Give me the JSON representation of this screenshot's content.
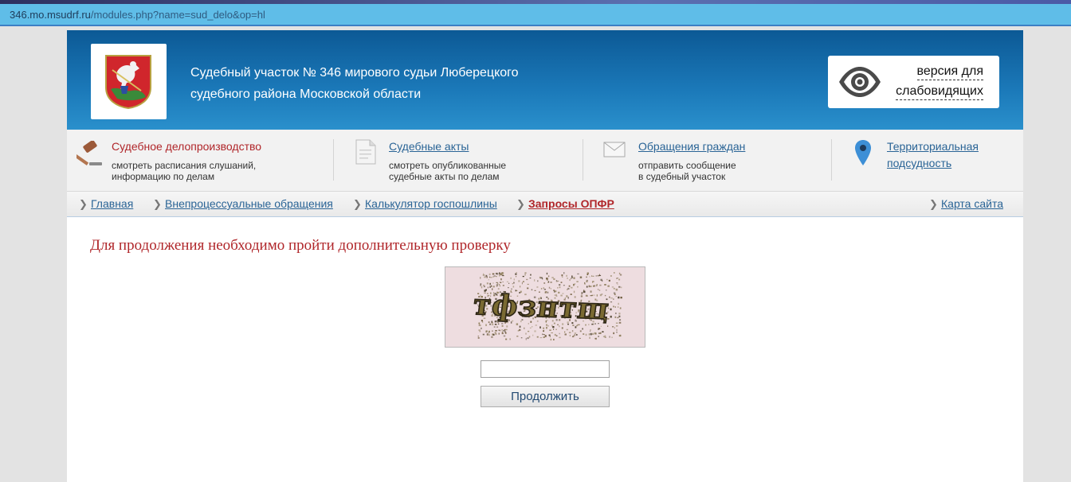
{
  "browser": {
    "url_host": "346.mo.msudrf.ru",
    "url_path": "/modules.php?name=sud_delo&op=hl"
  },
  "header": {
    "title_line1": "Судебный участок № 346 мирового судьи Люберецкого",
    "title_line2": "судебного района Московской области",
    "vision_line1": "версия для",
    "vision_line2": "слабовидящих"
  },
  "menu": [
    {
      "title": "Судебное делопроизводство",
      "sub1": "смотреть расписания слушаний,",
      "sub2": "информацию по делам",
      "icon": "gavel-icon"
    },
    {
      "title": "Судебные акты",
      "sub1": "смотреть опубликованные",
      "sub2": "судебные акты по делам",
      "icon": "document-icon"
    },
    {
      "title": "Обращения граждан",
      "sub1": "отправить сообщение",
      "sub2": "в судебный участок",
      "icon": "envelope-icon"
    },
    {
      "title": "Территориальная",
      "title2": "подсудность",
      "icon": "map-pin-icon"
    }
  ],
  "breadcrumbs": [
    {
      "label": "Главная"
    },
    {
      "label": "Внепроцессуальные обращения"
    },
    {
      "label": "Калькулятор госпошлины"
    },
    {
      "label": "Запросы ОПФР"
    }
  ],
  "sitemap_label": "Карта сайта",
  "main": {
    "heading": "Для продолжения необходимо пройти дополнительную проверку",
    "captcha_text": "тфзнтщ",
    "input_value": "",
    "button_label": "Продолжить"
  },
  "colors": {
    "header_blue": "#1b79b9",
    "accent_red": "#b0262a",
    "link_blue": "#2a6496"
  }
}
